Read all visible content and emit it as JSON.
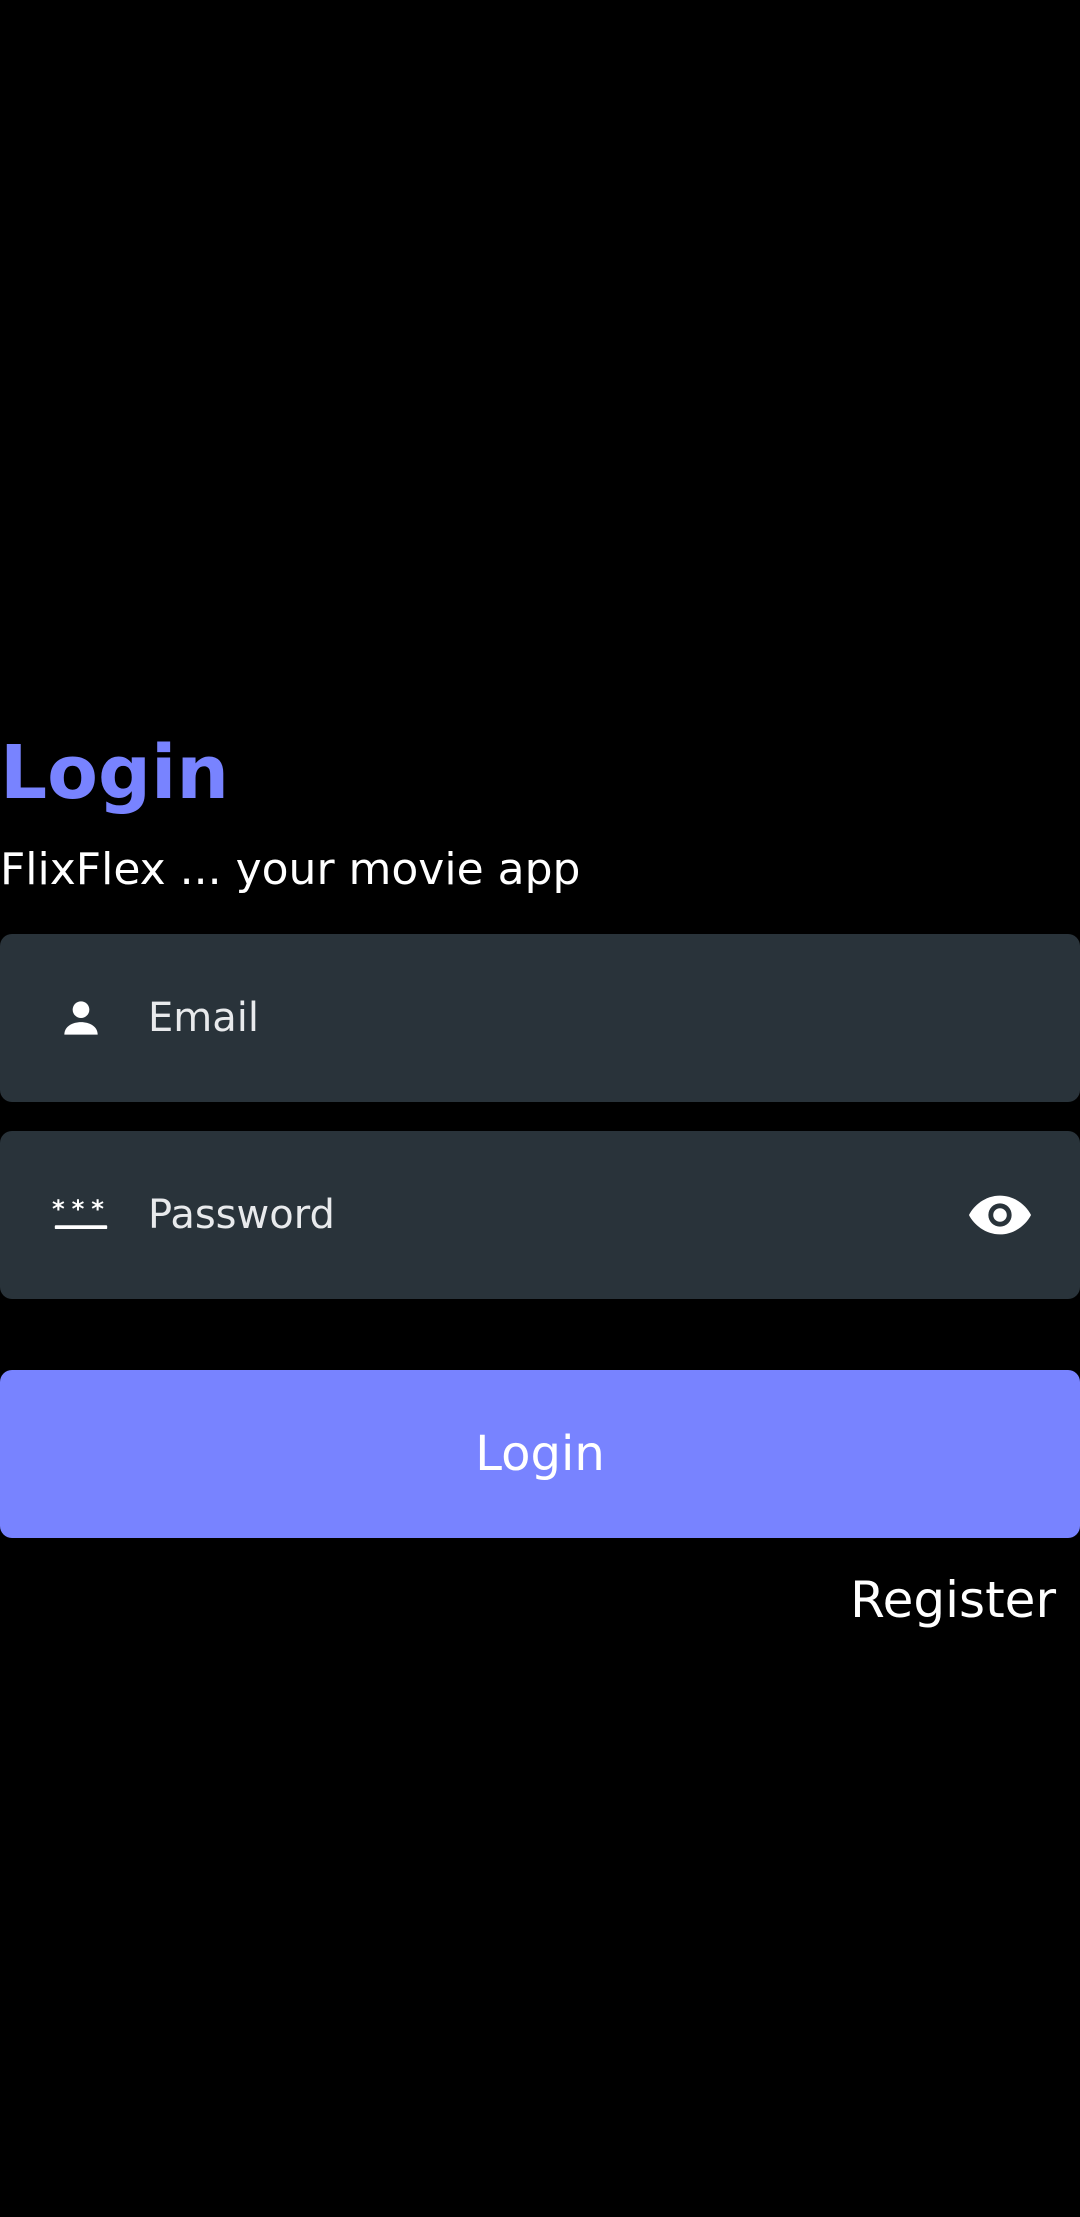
{
  "login_screen": {
    "title": "Login",
    "subtitle": "FlixFlex ... your movie app",
    "email_field": {
      "placeholder": "Email",
      "value": "",
      "icon": "person-icon"
    },
    "password_field": {
      "placeholder": "Password",
      "value": "",
      "icon": "password-icon",
      "toggle_icon": "eye-icon"
    },
    "login_button_label": "Login",
    "register_link_label": "Register"
  },
  "colors": {
    "accent": "#7883ff",
    "field_background": "#29333a",
    "background": "#000000",
    "text": "#ffffff"
  }
}
